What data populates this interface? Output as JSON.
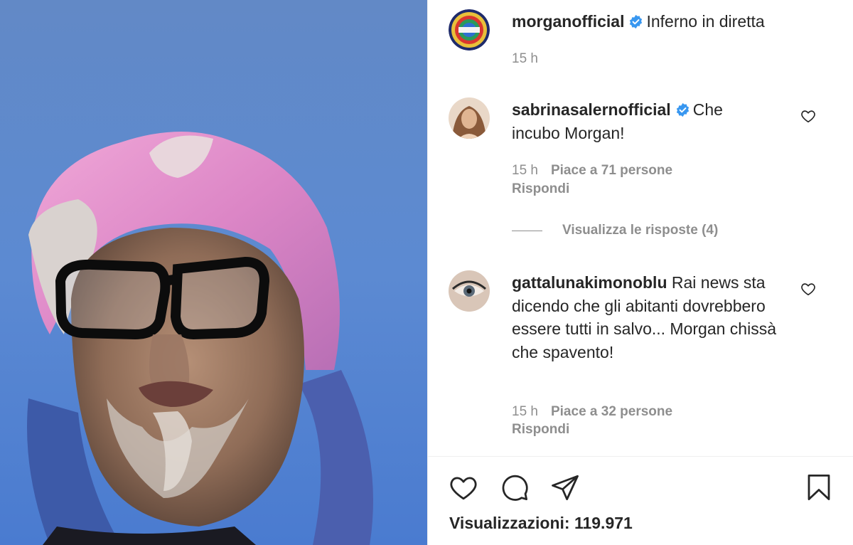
{
  "post": {
    "author": "morganofficial",
    "caption": "Inferno in diretta",
    "time": "15 h",
    "views_label": "Visualizzazioni: 119.971"
  },
  "comments": [
    {
      "username": "sabrinasalernofficial",
      "text": "Che incubo Morgan!",
      "time": "15 h",
      "likes": "Piace a 71 persone",
      "reply_label": "Rispondi",
      "view_replies": "Visualizza le risposte (4)"
    },
    {
      "username": "gattalunakimonoblu",
      "text": "Rai news sta dicendo che gli abitanti dovrebbero essere tutti in salvo... Morgan chissà che spavento!",
      "time": "15 h",
      "likes": "Piace a 32 persone",
      "reply_label": "Rispondi"
    }
  ],
  "icons": {
    "verified": "verified-badge-icon",
    "like": "heart-icon",
    "comment": "comment-bubble-icon",
    "share": "paper-plane-icon",
    "save": "bookmark-icon"
  },
  "colors": {
    "verified_blue": "#3897f0",
    "text_primary": "#262626",
    "text_secondary": "#8e8e8e",
    "sky_blue": "#5e8bd0",
    "hair_pink": "#e38fc9"
  }
}
